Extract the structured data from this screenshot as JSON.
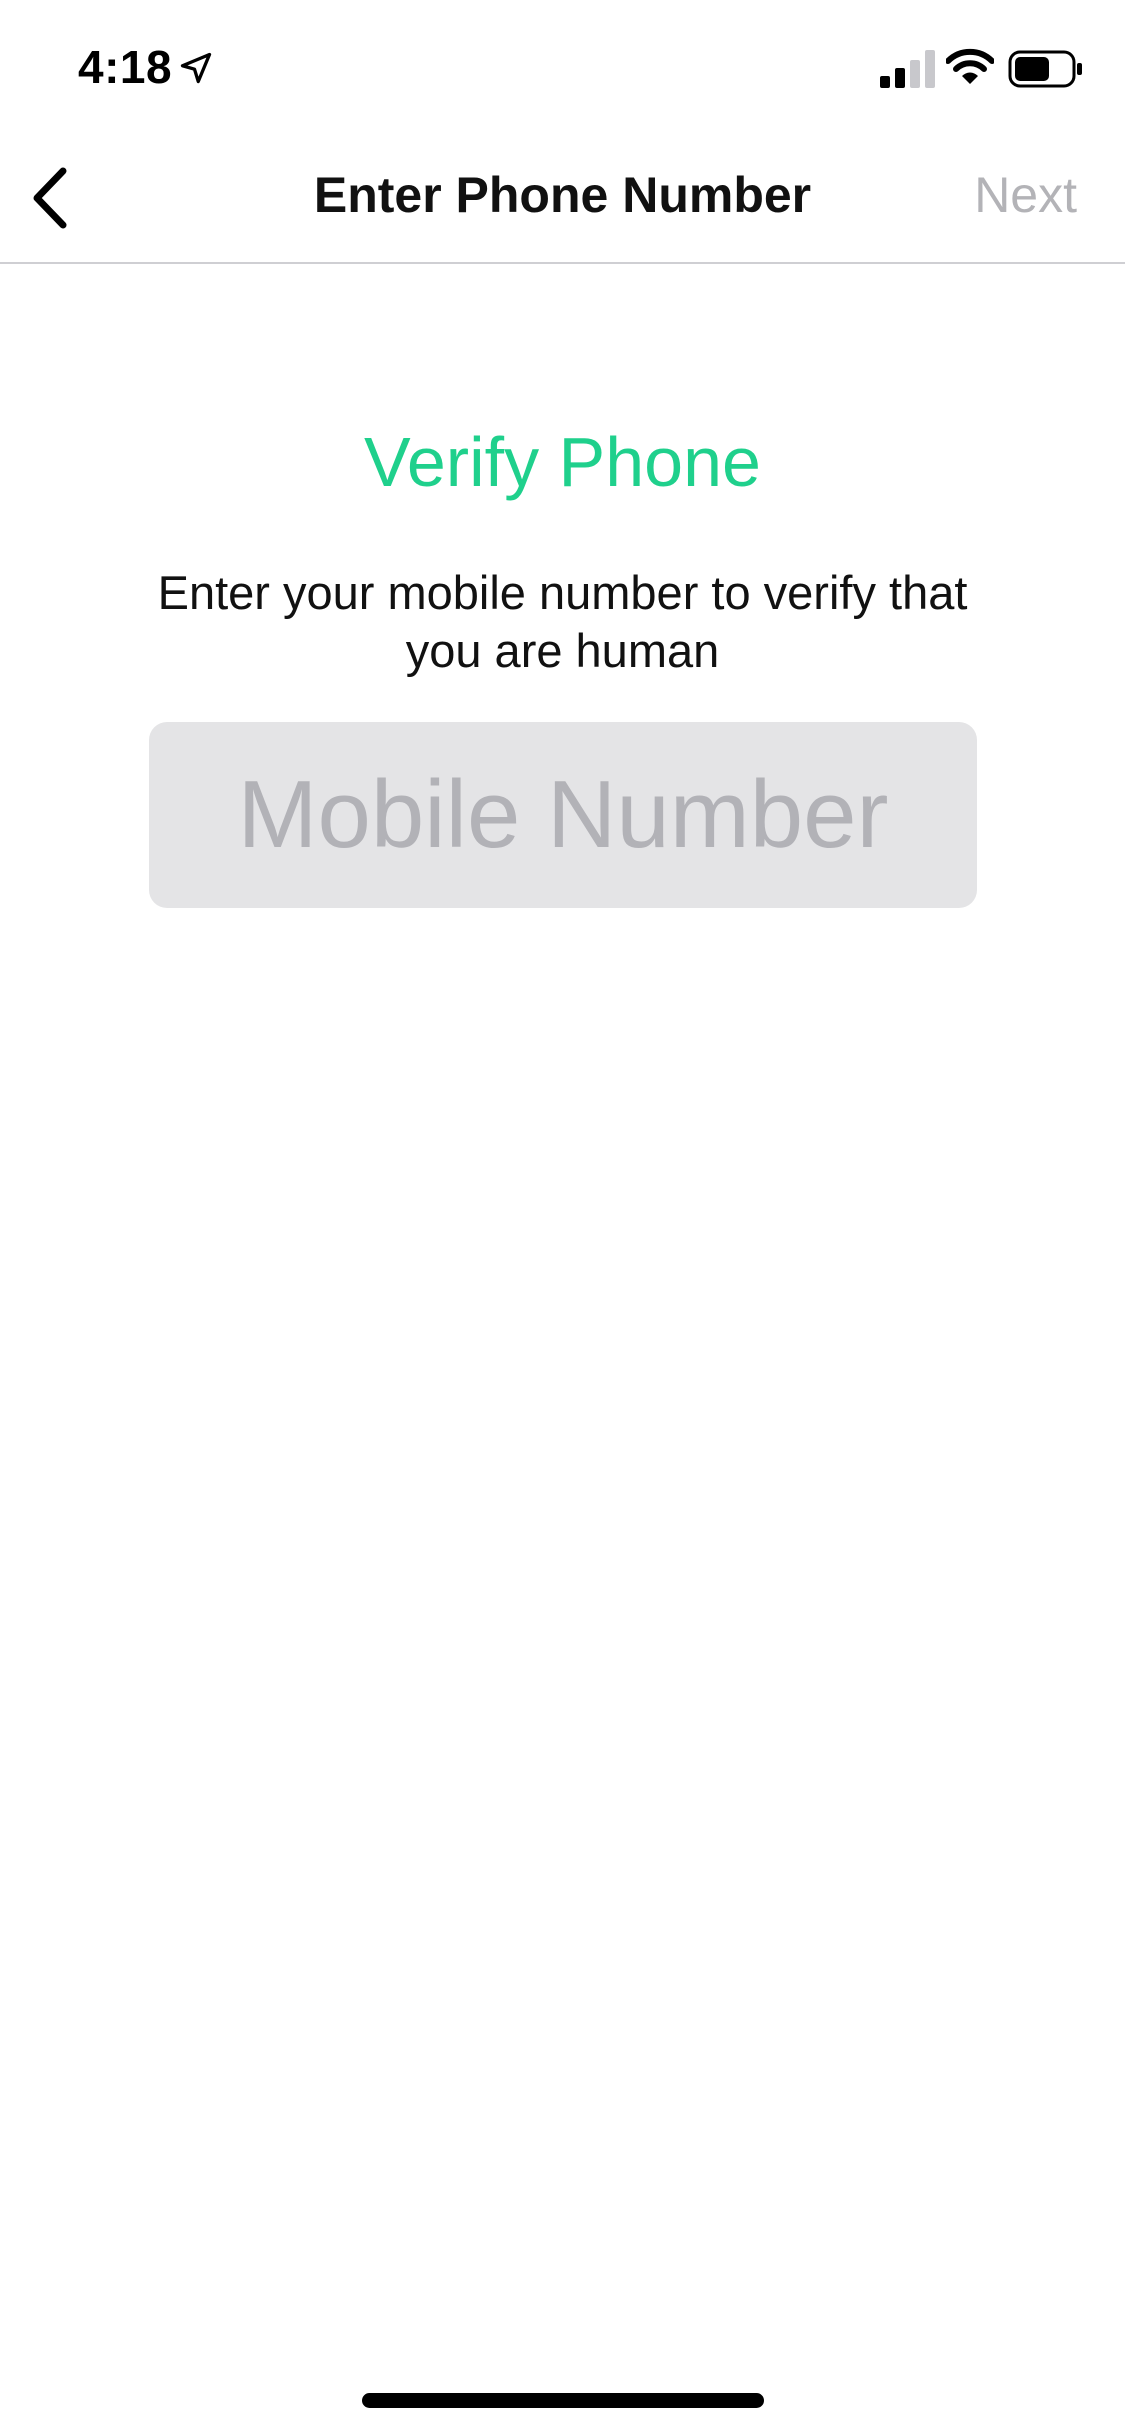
{
  "status_bar": {
    "time": "4:18",
    "icons": [
      "location-arrow-icon",
      "cellular-signal-icon",
      "wifi-icon",
      "battery-icon"
    ]
  },
  "nav": {
    "title": "Enter Phone Number",
    "back_icon": "chevron-left-icon",
    "next_label": "Next"
  },
  "main": {
    "heading": "Verify Phone",
    "subtitle": "Enter your mobile number to verify that you are human",
    "phone_input": {
      "value": "",
      "placeholder": "Mobile Number"
    }
  },
  "colors": {
    "accent": "#1fd08c",
    "disabled_text": "#b3b3b7",
    "input_background": "#e4e4e6",
    "divider": "#cfcfd3"
  }
}
